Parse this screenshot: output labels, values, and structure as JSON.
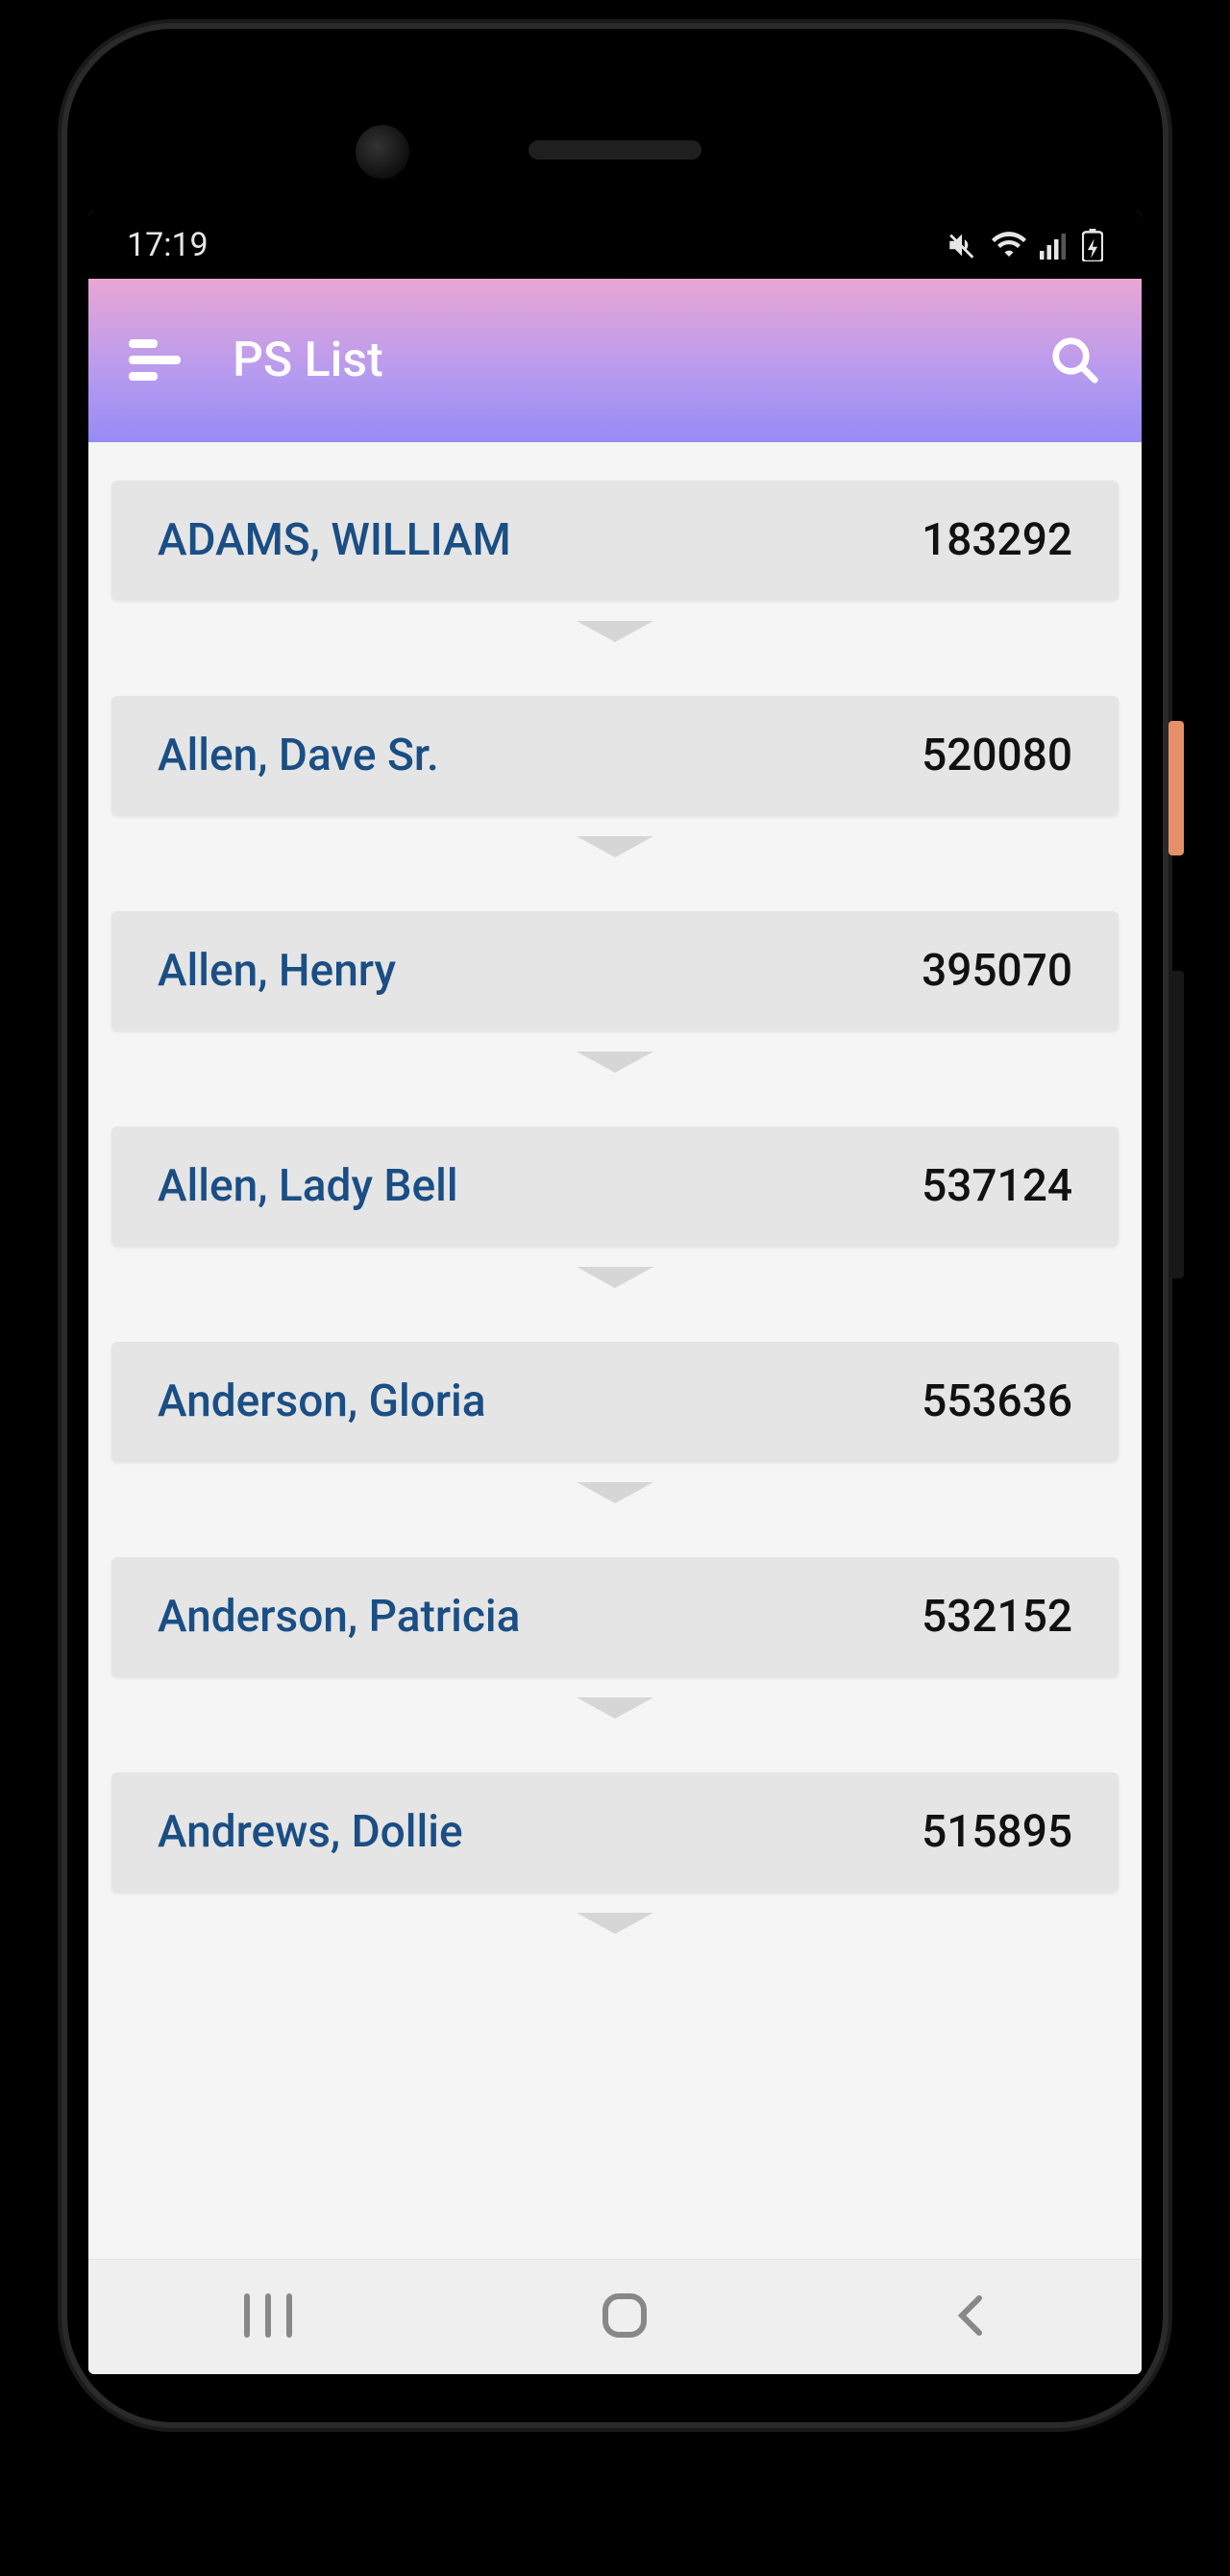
{
  "status_bar": {
    "time": "17:19"
  },
  "header": {
    "title": "PS List"
  },
  "list": [
    {
      "name": "ADAMS, WILLIAM",
      "id": "183292"
    },
    {
      "name": "Allen, Dave Sr.",
      "id": "520080"
    },
    {
      "name": "Allen, Henry",
      "id": "395070"
    },
    {
      "name": "Allen, Lady Bell",
      "id": "537124"
    },
    {
      "name": "Anderson, Gloria",
      "id": "553636"
    },
    {
      "name": "Anderson, Patricia",
      "id": "532152"
    },
    {
      "name": "Andrews, Dollie",
      "id": "515895"
    }
  ]
}
